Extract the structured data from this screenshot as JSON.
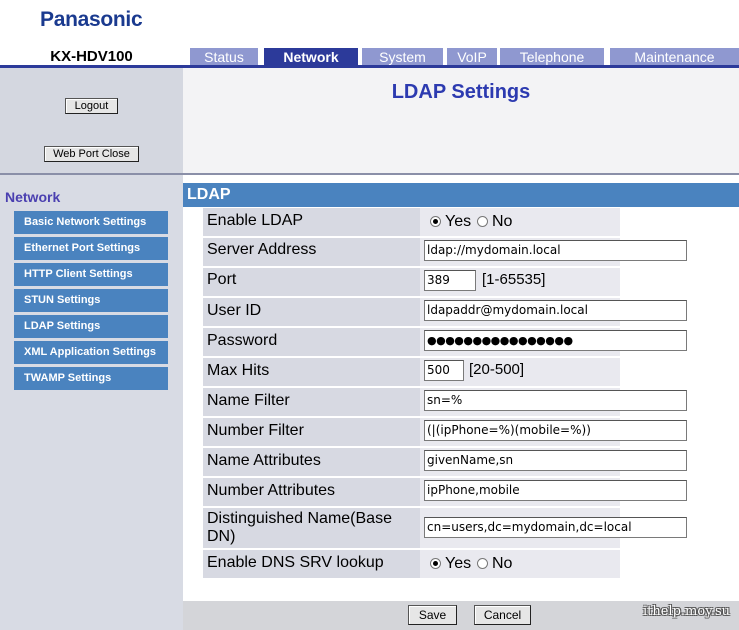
{
  "header": {
    "brand": "Panasonic",
    "model": "KX-HDV100",
    "tabs": [
      {
        "label": "Status",
        "active": false
      },
      {
        "label": "Network",
        "active": true
      },
      {
        "label": "System",
        "active": false
      },
      {
        "label": "VoIP",
        "active": false
      },
      {
        "label": "Telephone",
        "active": false
      },
      {
        "label": "Maintenance",
        "active": false
      }
    ]
  },
  "sidebar": {
    "logout_label": "Logout",
    "web_port_close_label": "Web Port Close",
    "heading": "Network",
    "items": [
      {
        "label": "Basic Network Settings"
      },
      {
        "label": "Ethernet Port Settings"
      },
      {
        "label": "HTTP Client Settings"
      },
      {
        "label": "STUN Settings"
      },
      {
        "label": "LDAP Settings"
      },
      {
        "label": "XML Application Settings"
      },
      {
        "label": "TWAMP Settings"
      }
    ]
  },
  "main": {
    "title": "LDAP Settings",
    "section": "LDAP",
    "fields": {
      "enable_ldap": {
        "label": "Enable LDAP",
        "yes": "Yes",
        "no": "No",
        "selected": "Yes"
      },
      "server_address": {
        "label": "Server Address",
        "value": "ldap://mydomain.local"
      },
      "port": {
        "label": "Port",
        "value": "389",
        "range": "[1-65535]"
      },
      "user_id": {
        "label": "User ID",
        "value": "ldapaddr@mydomain.local"
      },
      "password": {
        "label": "Password",
        "value": "●●●●●●●●●●●●●●●●"
      },
      "max_hits": {
        "label": "Max Hits",
        "value": "500",
        "range": "[20-500]"
      },
      "name_filter": {
        "label": "Name Filter",
        "value": "sn=%"
      },
      "number_filter": {
        "label": "Number Filter",
        "value": "(|(ipPhone=%)(mobile=%))"
      },
      "name_attributes": {
        "label": "Name Attributes",
        "value": "givenName,sn"
      },
      "number_attributes": {
        "label": "Number Attributes",
        "value": "ipPhone,mobile"
      },
      "base_dn": {
        "label": "Distinguished Name(Base DN)",
        "value": "cn=users,dc=mydomain,dc=local"
      },
      "dns_srv": {
        "label": "Enable DNS SRV lookup",
        "yes": "Yes",
        "no": "No",
        "selected": "Yes"
      }
    },
    "save_label": "Save",
    "cancel_label": "Cancel"
  },
  "watermark": "ithelp.moy.su"
}
